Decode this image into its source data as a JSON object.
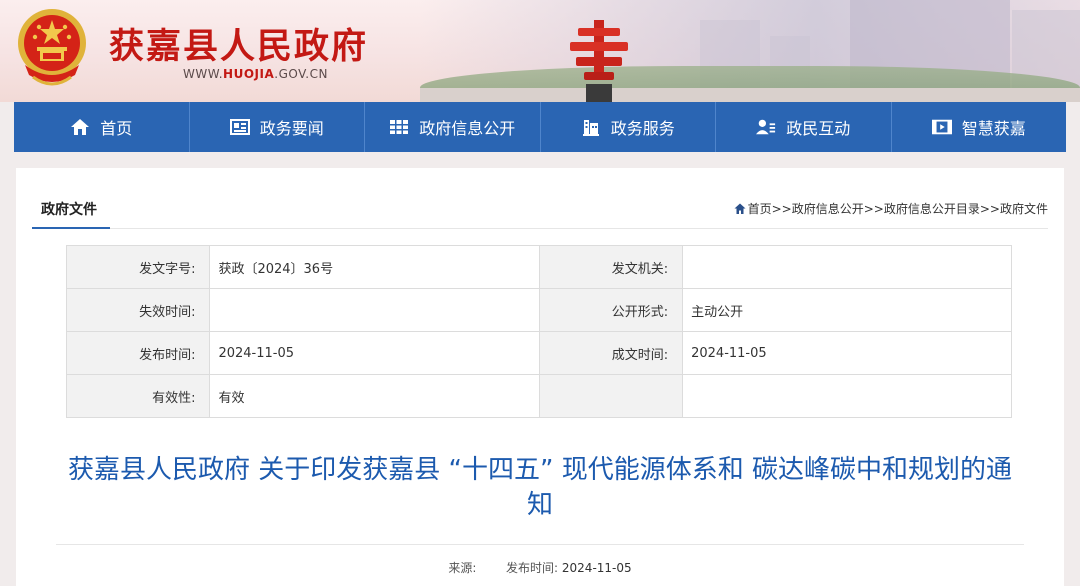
{
  "site": {
    "title": "获嘉县人民政府",
    "url_prefix": "WWW.",
    "url_brand": "HUOJIA",
    "url_suffix": ".GOV.CN"
  },
  "nav": {
    "items": [
      {
        "label": "首页",
        "icon": "home-icon"
      },
      {
        "label": "政务要闻",
        "icon": "newspaper-icon"
      },
      {
        "label": "政府信息公开",
        "icon": "book-icon"
      },
      {
        "label": "政务服务",
        "icon": "building-icon"
      },
      {
        "label": "政民互动",
        "icon": "user-chat-icon"
      },
      {
        "label": "智慧获嘉",
        "icon": "film-icon"
      }
    ]
  },
  "section": {
    "title": "政府文件"
  },
  "breadcrumb": {
    "home": "首页",
    "sep": ">>",
    "items": [
      "政府信息公开",
      "政府信息公开目录",
      "政府文件"
    ]
  },
  "meta": {
    "rows": [
      {
        "l1": "发文字号:",
        "v1": "获政〔2024〕36号",
        "l2": "发文机关:",
        "v2": ""
      },
      {
        "l1": "失效时间:",
        "v1": "",
        "l2": "公开形式:",
        "v2": "主动公开"
      },
      {
        "l1": "发布时间:",
        "v1": "2024-11-05",
        "l2": "成文时间:",
        "v2": "2024-11-05"
      },
      {
        "l1": "有效性:",
        "v1": "有效",
        "l2": "",
        "v2": ""
      }
    ]
  },
  "document": {
    "title": "获嘉县人民政府 关于印发获嘉县 “十四五” 现代能源体系和 碳达峰碳中和规划的通知",
    "source_label": "来源:",
    "source_value": "",
    "date_label": "发布时间:",
    "date_value": "2024-11-05"
  },
  "colors": {
    "brand_red": "#c31914",
    "nav_blue": "#2a65b3",
    "title_blue": "#1c5aae"
  }
}
